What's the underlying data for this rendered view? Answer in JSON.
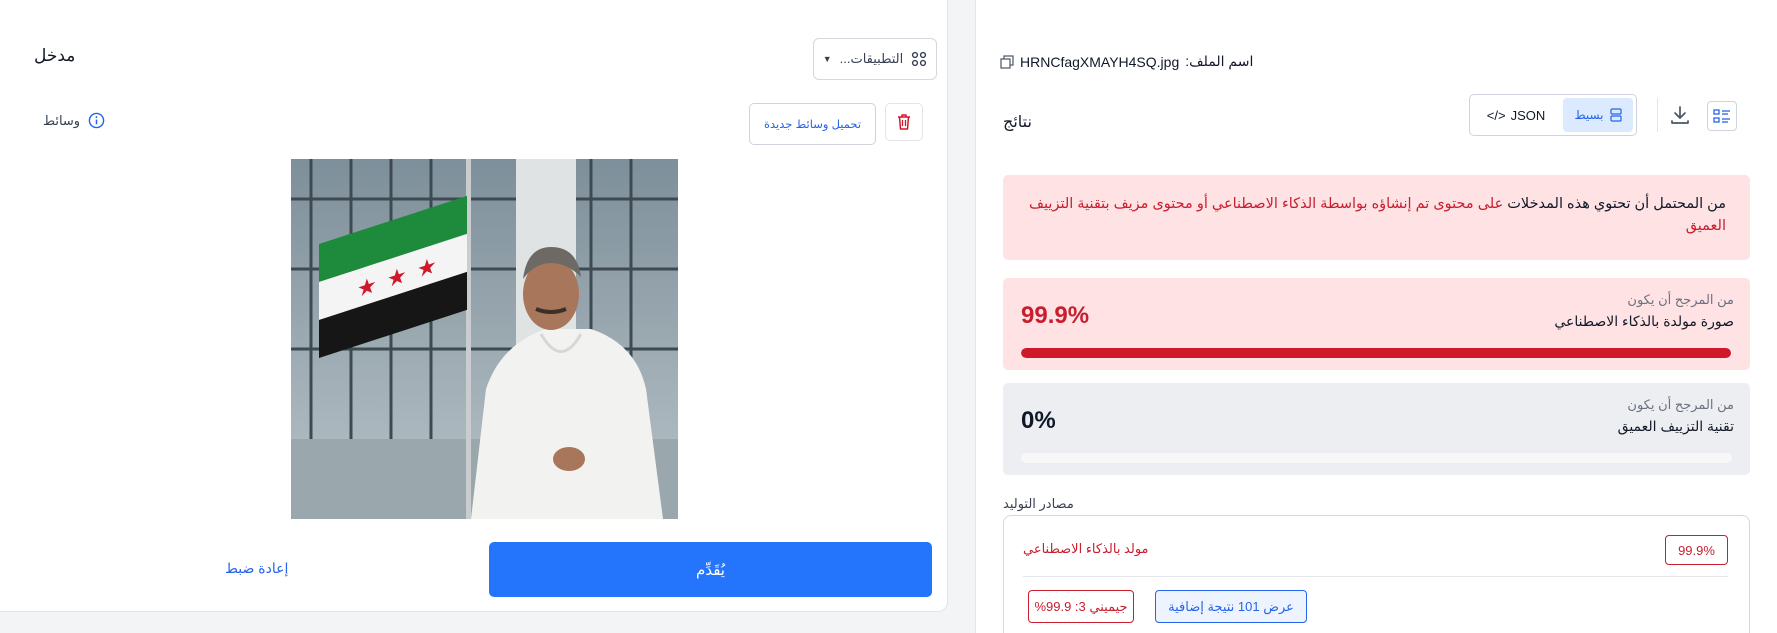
{
  "input_panel": {
    "title": "مدخل",
    "apps_button_label": "التطبيقات...",
    "apps_icon": "apps-grid-icon",
    "media_label": "وسائط",
    "upload_button_label": "تحميل وسائط جديدة",
    "submit_label": "يُقَدِّم",
    "reset_label": "إعادة ضبط"
  },
  "results_panel": {
    "filename_label": "اسم الملف:",
    "filename": "HRNCfagXMAYH4SQ.jpg",
    "title": "نتائج",
    "view_simple_label": "بسيط",
    "view_json_label": "JSON",
    "warning_prefix": "من المحتمل أن تحتوي هذه المدخلات ",
    "warning_highlight": "على محتوى تم إنشاؤه بواسطة الذكاء الاصطناعي أو محتوى مزيف بتقنية التزييف العميق",
    "results": [
      {
        "likely_label": "من المرجح أن يكون",
        "label": "صورة مولدة بالذكاء الاصطناعي",
        "percent_text": "99.9%",
        "fraction": 0.999
      },
      {
        "likely_label": "من المرجح أن يكون",
        "label": "تقنية التزييف العميق",
        "percent_text": "0%",
        "fraction": 0
      }
    ],
    "sources_title": "مصادر التوليد",
    "source_label": "مولد بالذكاء الاصطناعي",
    "source_percent": "99.9%",
    "more_results_label": "عرض 101 نتيجة إضافية",
    "gemini_label": "جيميني 3: 99.9%"
  },
  "colors": {
    "accent": "#2575fc",
    "danger": "#c81e2e",
    "warning_bg": "#fee2e4"
  }
}
